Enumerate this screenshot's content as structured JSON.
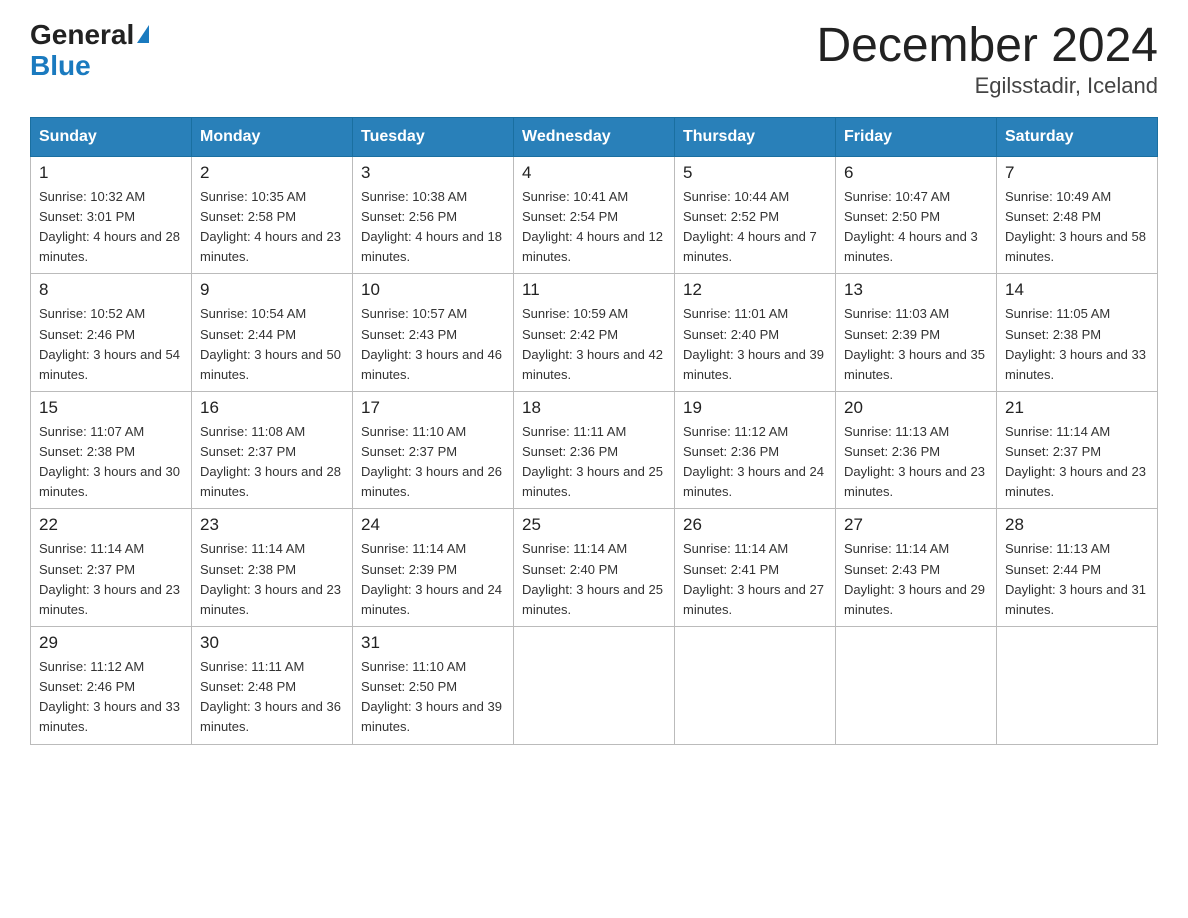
{
  "header": {
    "logo_general": "General",
    "logo_blue": "Blue",
    "title": "December 2024",
    "location": "Egilsstadir, Iceland"
  },
  "weekdays": [
    "Sunday",
    "Monday",
    "Tuesday",
    "Wednesday",
    "Thursday",
    "Friday",
    "Saturday"
  ],
  "weeks": [
    [
      {
        "day": "1",
        "sunrise": "10:32 AM",
        "sunset": "3:01 PM",
        "daylight": "4 hours and 28 minutes."
      },
      {
        "day": "2",
        "sunrise": "10:35 AM",
        "sunset": "2:58 PM",
        "daylight": "4 hours and 23 minutes."
      },
      {
        "day": "3",
        "sunrise": "10:38 AM",
        "sunset": "2:56 PM",
        "daylight": "4 hours and 18 minutes."
      },
      {
        "day": "4",
        "sunrise": "10:41 AM",
        "sunset": "2:54 PM",
        "daylight": "4 hours and 12 minutes."
      },
      {
        "day": "5",
        "sunrise": "10:44 AM",
        "sunset": "2:52 PM",
        "daylight": "4 hours and 7 minutes."
      },
      {
        "day": "6",
        "sunrise": "10:47 AM",
        "sunset": "2:50 PM",
        "daylight": "4 hours and 3 minutes."
      },
      {
        "day": "7",
        "sunrise": "10:49 AM",
        "sunset": "2:48 PM",
        "daylight": "3 hours and 58 minutes."
      }
    ],
    [
      {
        "day": "8",
        "sunrise": "10:52 AM",
        "sunset": "2:46 PM",
        "daylight": "3 hours and 54 minutes."
      },
      {
        "day": "9",
        "sunrise": "10:54 AM",
        "sunset": "2:44 PM",
        "daylight": "3 hours and 50 minutes."
      },
      {
        "day": "10",
        "sunrise": "10:57 AM",
        "sunset": "2:43 PM",
        "daylight": "3 hours and 46 minutes."
      },
      {
        "day": "11",
        "sunrise": "10:59 AM",
        "sunset": "2:42 PM",
        "daylight": "3 hours and 42 minutes."
      },
      {
        "day": "12",
        "sunrise": "11:01 AM",
        "sunset": "2:40 PM",
        "daylight": "3 hours and 39 minutes."
      },
      {
        "day": "13",
        "sunrise": "11:03 AM",
        "sunset": "2:39 PM",
        "daylight": "3 hours and 35 minutes."
      },
      {
        "day": "14",
        "sunrise": "11:05 AM",
        "sunset": "2:38 PM",
        "daylight": "3 hours and 33 minutes."
      }
    ],
    [
      {
        "day": "15",
        "sunrise": "11:07 AM",
        "sunset": "2:38 PM",
        "daylight": "3 hours and 30 minutes."
      },
      {
        "day": "16",
        "sunrise": "11:08 AM",
        "sunset": "2:37 PM",
        "daylight": "3 hours and 28 minutes."
      },
      {
        "day": "17",
        "sunrise": "11:10 AM",
        "sunset": "2:37 PM",
        "daylight": "3 hours and 26 minutes."
      },
      {
        "day": "18",
        "sunrise": "11:11 AM",
        "sunset": "2:36 PM",
        "daylight": "3 hours and 25 minutes."
      },
      {
        "day": "19",
        "sunrise": "11:12 AM",
        "sunset": "2:36 PM",
        "daylight": "3 hours and 24 minutes."
      },
      {
        "day": "20",
        "sunrise": "11:13 AM",
        "sunset": "2:36 PM",
        "daylight": "3 hours and 23 minutes."
      },
      {
        "day": "21",
        "sunrise": "11:14 AM",
        "sunset": "2:37 PM",
        "daylight": "3 hours and 23 minutes."
      }
    ],
    [
      {
        "day": "22",
        "sunrise": "11:14 AM",
        "sunset": "2:37 PM",
        "daylight": "3 hours and 23 minutes."
      },
      {
        "day": "23",
        "sunrise": "11:14 AM",
        "sunset": "2:38 PM",
        "daylight": "3 hours and 23 minutes."
      },
      {
        "day": "24",
        "sunrise": "11:14 AM",
        "sunset": "2:39 PM",
        "daylight": "3 hours and 24 minutes."
      },
      {
        "day": "25",
        "sunrise": "11:14 AM",
        "sunset": "2:40 PM",
        "daylight": "3 hours and 25 minutes."
      },
      {
        "day": "26",
        "sunrise": "11:14 AM",
        "sunset": "2:41 PM",
        "daylight": "3 hours and 27 minutes."
      },
      {
        "day": "27",
        "sunrise": "11:14 AM",
        "sunset": "2:43 PM",
        "daylight": "3 hours and 29 minutes."
      },
      {
        "day": "28",
        "sunrise": "11:13 AM",
        "sunset": "2:44 PM",
        "daylight": "3 hours and 31 minutes."
      }
    ],
    [
      {
        "day": "29",
        "sunrise": "11:12 AM",
        "sunset": "2:46 PM",
        "daylight": "3 hours and 33 minutes."
      },
      {
        "day": "30",
        "sunrise": "11:11 AM",
        "sunset": "2:48 PM",
        "daylight": "3 hours and 36 minutes."
      },
      {
        "day": "31",
        "sunrise": "11:10 AM",
        "sunset": "2:50 PM",
        "daylight": "3 hours and 39 minutes."
      },
      null,
      null,
      null,
      null
    ]
  ]
}
